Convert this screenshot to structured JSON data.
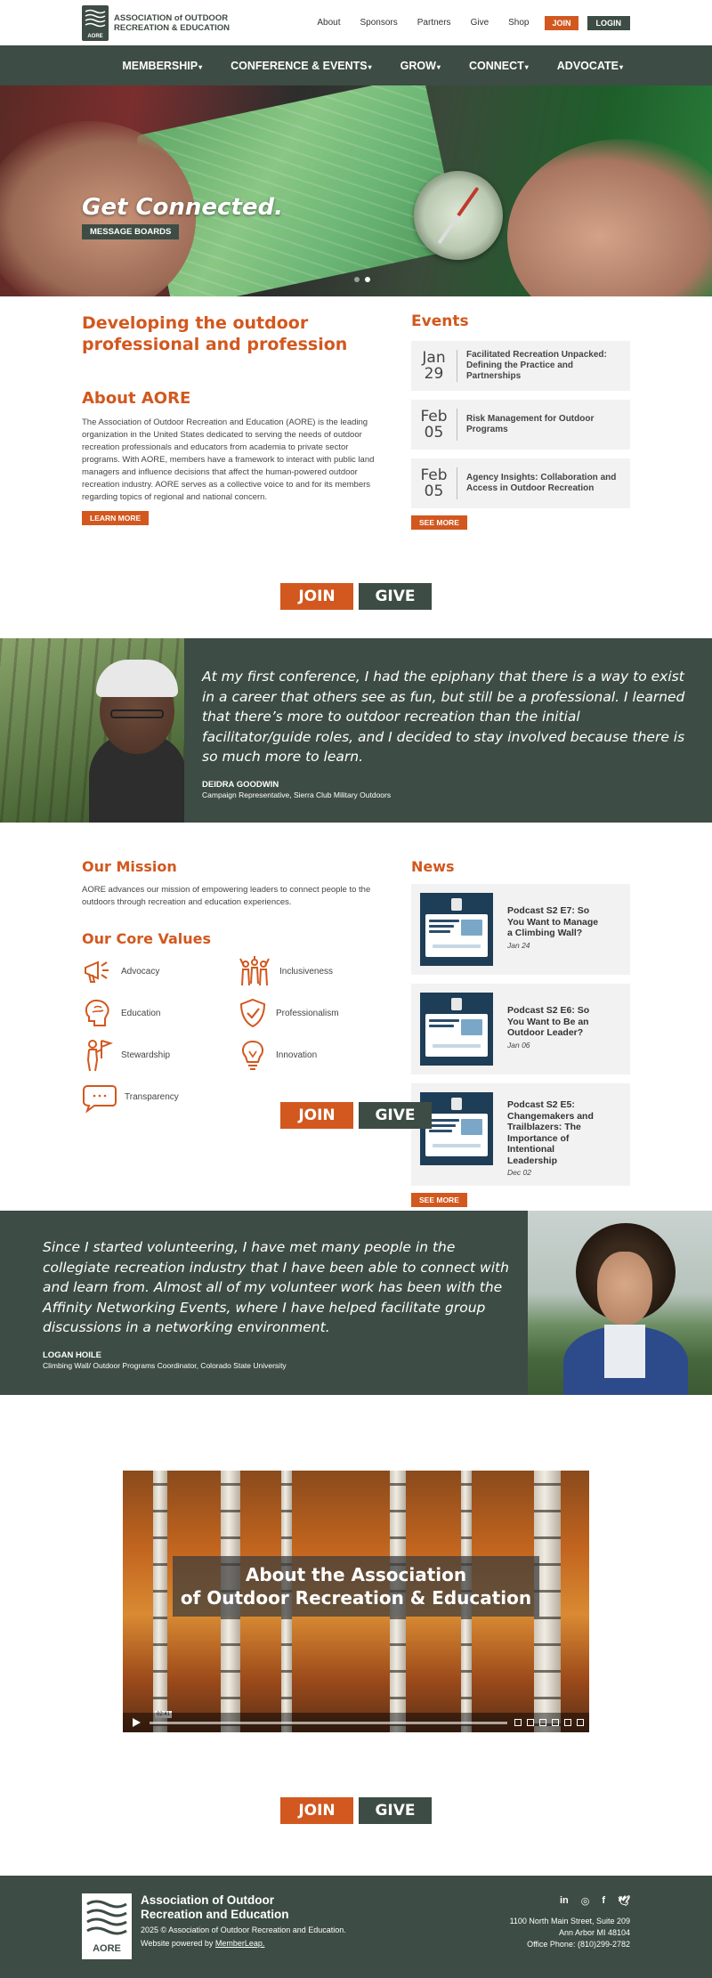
{
  "brand": {
    "logo_line1": "ASSOCIATION of OUTDOOR",
    "logo_line2": "RECREATION & EDUCATION",
    "logo_mark": "AORE"
  },
  "topnav": {
    "items": [
      "About",
      "Sponsors",
      "Partners",
      "Give",
      "Shop"
    ],
    "join": "JOIN",
    "login": "LOGIN"
  },
  "mainnav": {
    "items": [
      "MEMBERSHIP",
      "CONFERENCE & EVENTS",
      "GROW",
      "CONNECT",
      "ADVOCATE"
    ]
  },
  "hero": {
    "title": "Get Connected.",
    "button": "MESSAGE BOARDS",
    "slide_count": 2,
    "active_slide": 2
  },
  "intro": {
    "heading": "Developing the outdoor professional and profession",
    "about_heading": "About AORE",
    "about_text": "The Association of Outdoor Recreation and Education (AORE) is the leading organization in the United States dedicated to serving the needs of outdoor recreation professionals and educators from academia to private sector programs. With AORE, members have a framework to interact with public land managers and influence decisions that affect the human-powered outdoor recreation industry. AORE serves as a collective voice to and for its members regarding topics of regional and national concern.",
    "learn_more": "LEARN MORE"
  },
  "events": {
    "heading": "Events",
    "items": [
      {
        "month": "Jan",
        "day": "29",
        "title": "Facilitated Recreation Unpacked: Defining the Practice and Partnerships"
      },
      {
        "month": "Feb",
        "day": "05",
        "title": "Risk Management for Outdoor Programs"
      },
      {
        "month": "Feb",
        "day": "05",
        "title": "Agency Insights: Collaboration and Access in Outdoor Recreation"
      }
    ],
    "see_more": "SEE MORE"
  },
  "cta": {
    "join": "JOIN",
    "give": "GIVE"
  },
  "testimonial1": {
    "quote": "At my first conference, I had the epiphany that there is a way to exist in a career that others see as fun, but still be a professional. I learned that there’s more to outdoor recreation than the initial facilitator/guide roles, and I decided to stay involved because there is so much more to learn.",
    "name": "DEIDRA GOODWIN",
    "role": "Campaign Representative, Sierra Club Military Outdoors"
  },
  "mission": {
    "heading": "Our Mission",
    "text": "AORE advances our mission of empowering leaders to connect people to the outdoors through recreation and education experiences.",
    "values_heading": "Our Core Values",
    "values": [
      {
        "label": "Advocacy",
        "icon": "megaphone-icon"
      },
      {
        "label": "Inclusiveness",
        "icon": "people-icon"
      },
      {
        "label": "Education",
        "icon": "brain-icon"
      },
      {
        "label": "Professionalism",
        "icon": "shield-check-icon"
      },
      {
        "label": "Stewardship",
        "icon": "person-flag-icon"
      },
      {
        "label": "Innovation",
        "icon": "lightbulb-icon"
      },
      {
        "label": "Transparency",
        "icon": "speech-bubble-icon"
      }
    ]
  },
  "news": {
    "heading": "News",
    "items": [
      {
        "title": "Podcast S2 E7: So You Want to Manage a Climbing Wall?",
        "date": "Jan 24"
      },
      {
        "title": "Podcast S2 E6: So You Want to Be an Outdoor Leader?",
        "date": "Jan 06"
      },
      {
        "title": "Podcast S2 E5: Changemakers and Trailblazers: The Importance of Intentional Leadership",
        "date": "Dec 02"
      }
    ],
    "see_more": "SEE MORE"
  },
  "testimonial2": {
    "quote": "Since I started volunteering, I have met many people in the collegiate recreation industry that I have been able to connect with and learn from. Almost all of my volunteer work has been with the Affinity Networking Events, where I have helped facilitate group discussions in a networking environment.",
    "name": "LOGAN HOILE",
    "role": "Climbing Wall/ Outdoor Programs Coordinator, Colorado State University"
  },
  "video": {
    "title_line1": "About the Association",
    "title_line2": "of Outdoor Recreation & Education",
    "time": "02:41"
  },
  "footer": {
    "name_line1": "Association of Outdoor",
    "name_line2": "Recreation and Education",
    "copyright": "2025 © Association of Outdoor Recreation and Education.",
    "powered_prefix": "Website powered by ",
    "powered_link": "MemberLeap.",
    "social": [
      "in",
      "ig",
      "f",
      "tw"
    ],
    "address1": "1100 North Main Street, Suite 209",
    "address2": "Ann Arbor MI 48104",
    "phone": "Office Phone: (810)299-2782"
  },
  "colors": {
    "green": "#3d4c44",
    "orange": "#d2581f",
    "light_gray": "#f2f2f2"
  }
}
